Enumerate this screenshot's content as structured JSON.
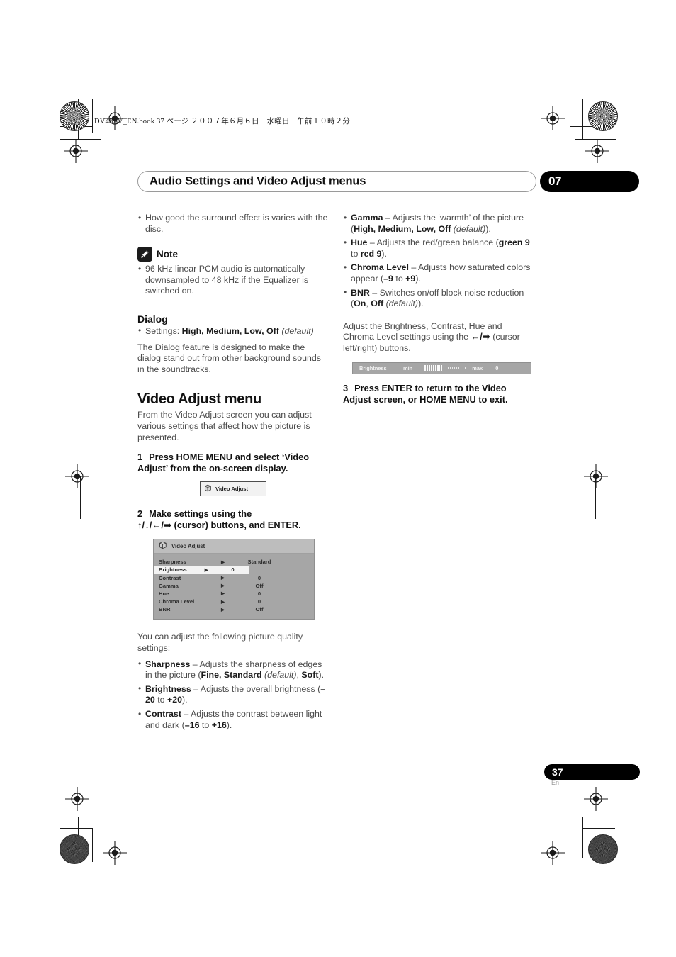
{
  "header": {
    "book_line": "DV48AV_EN.book  37 ページ  ２００７年６月６日　水曜日　午前１０時２分"
  },
  "title_bar": {
    "title": "Audio Settings and Video Adjust menus",
    "chapter_number": "07"
  },
  "footer": {
    "page_number": "37",
    "language": "En"
  },
  "left_column": {
    "surround_bullet": "How good the surround effect is varies with the disc.",
    "note": {
      "icon": "pencil-note-icon",
      "label": "Note",
      "bullet": "96 kHz linear PCM audio is automatically downsampled to 48 kHz if the Equalizer is switched on."
    },
    "dialog": {
      "heading": "Dialog",
      "settings_prefix": "Settings: ",
      "settings_values": "High, Medium, Low, Off",
      "settings_default": "(default)",
      "paragraph": "The Dialog feature is designed to make the dialog stand out from other background sounds in the soundtracks."
    },
    "video_adjust": {
      "heading": "Video Adjust menu",
      "intro": "From the Video Adjust screen you can adjust various settings that affect how the picture is presented.",
      "step1_num": "1",
      "step1_text": "Press HOME MENU and select ‘Video Adjust’ from the on-screen display.",
      "step2_num": "2",
      "step2_text_line1": "Make settings using the",
      "step2_arrows": "↑/↓/←/➡",
      "step2_text_line2": " (cursor) buttons, and ENTER.",
      "osd_chip": {
        "icon": "cube-3d-icon",
        "label": "Video Adjust"
      },
      "osd_menu": {
        "icon": "cube-3d-icon",
        "title": "Video Adjust",
        "arrow_glyph": "▶",
        "rows": [
          {
            "name": "Sharpness",
            "value": "Standard",
            "selected": false
          },
          {
            "name": "Brightness",
            "value": "0",
            "selected": true
          },
          {
            "name": "Contrast",
            "value": "0",
            "selected": false
          },
          {
            "name": "Gamma",
            "value": "Off",
            "selected": false
          },
          {
            "name": "Hue",
            "value": "0",
            "selected": false
          },
          {
            "name": "Chroma Level",
            "value": "0",
            "selected": false
          },
          {
            "name": "BNR",
            "value": "Off",
            "selected": false
          }
        ]
      },
      "list_intro": "You can adjust the following picture quality settings:",
      "settings_list": [
        {
          "name": "Sharpness",
          "desc_1": " – Adjusts the sharpness of edges in the picture (",
          "values": "Fine, Standard",
          "default_note": "(default)",
          "desc_2": ", ",
          "value_2": "Soft",
          "desc_3": ")."
        },
        {
          "name": "Brightness",
          "desc_1": " – Adjusts the overall brightness (",
          "range_low": "–20",
          "range_sep": " to ",
          "range_high": "+20",
          "desc_3": ")."
        },
        {
          "name": "Contrast",
          "desc_1": " – Adjusts the contrast between light and dark (",
          "range_low": "–16",
          "range_sep": " to ",
          "range_high": "+16",
          "desc_3": ")."
        }
      ]
    }
  },
  "right_column": {
    "settings_list": [
      {
        "name": "Gamma",
        "desc_1": " – Adjusts the ‘warmth’ of the picture (",
        "values": "High, Medium, Low, Off",
        "default_note": "(default)",
        "desc_3": ")."
      },
      {
        "name": "Hue",
        "desc_1": " – Adjusts the red/green balance (",
        "values": "green 9",
        "range_sep": " to ",
        "values_2": "red 9",
        "desc_3": ")."
      },
      {
        "name": "Chroma Level",
        "desc_1": " – Adjusts how saturated colors appear (",
        "values": "–9",
        "range_sep": " to ",
        "values_2": "+9",
        "desc_3": ")."
      },
      {
        "name": "BNR",
        "desc_1": " – Switches on/off block noise reduction (",
        "values": "On",
        "range_sep": ", ",
        "values_2": "Off",
        "default_note": "(default)",
        "desc_3": ")."
      }
    ],
    "adjust_paragraph_1": "Adjust the Brightness, Contrast, Hue and Chroma Level settings using the ",
    "adjust_arrows": "←/➡",
    "adjust_paragraph_2": " (cursor left/right) buttons.",
    "osd_bar": {
      "label": "Brightness",
      "min_label": "min",
      "max_label": "max",
      "value": "0",
      "filled_segments": 10,
      "empty_segments": 10
    },
    "step3_num": "3",
    "step3_text": "Press ENTER to return to the Video Adjust screen, or HOME MENU to exit."
  }
}
